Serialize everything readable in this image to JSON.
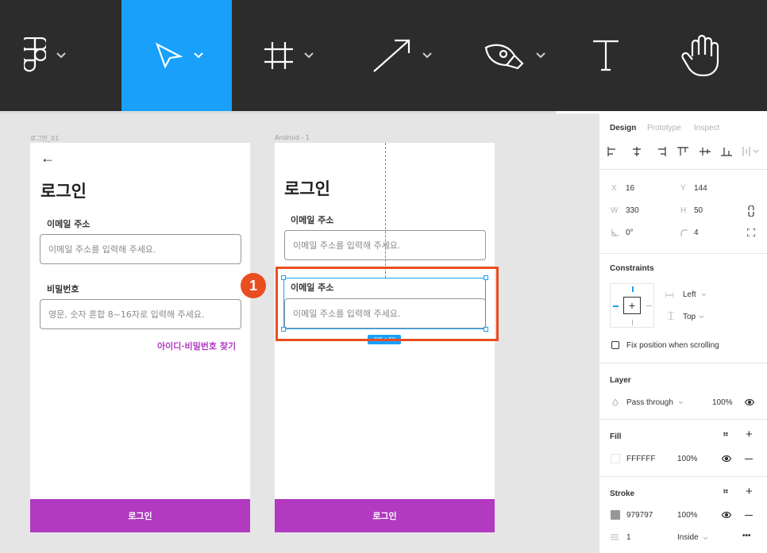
{
  "toolbar": {
    "tools": [
      "figma-menu",
      "move",
      "frame",
      "line",
      "pen",
      "text",
      "hand"
    ],
    "active_tool": "move"
  },
  "canvas": {
    "frame1": {
      "label": "로그인_01",
      "back": "←",
      "title": "로그인",
      "email_label": "이메일 주소",
      "email_placeholder": "이메일 주소를 입력해 주세요.",
      "password_label": "비밀번호",
      "password_placeholder": "영문, 숫자 혼합 8~16자로 입력해 주세요.",
      "find_link": "아이디·비밀번호 찾기",
      "login_button": "로그인"
    },
    "frame2": {
      "label": "Android - 1",
      "title": "로그인",
      "email_label": "이메일 주소",
      "email_placeholder": "이메일 주소를 입력해 주세요.",
      "dup_email_label": "이메일 주소",
      "dup_email_placeholder": "이메일 주소를 입력해 주세요.",
      "login_button": "로그인"
    },
    "step_badge": "1",
    "size_badge": "330 × 50"
  },
  "panel": {
    "tabs": [
      "Design",
      "Prototype",
      "Inspect"
    ],
    "active_tab": "Design",
    "x_label": "X",
    "x": "16",
    "y_label": "Y",
    "y": "144",
    "w_label": "W",
    "w": "330",
    "h_label": "H",
    "h": "50",
    "rotation": "0°",
    "radius": "4",
    "constraints_title": "Constraints",
    "constraint_h": "Left",
    "constraint_v": "Top",
    "fix_position": "Fix position when scrolling",
    "layer_title": "Layer",
    "blend": "Pass through",
    "layer_opacity": "100%",
    "fill_title": "Fill",
    "fill_hex": "FFFFFF",
    "fill_opacity": "100%",
    "stroke_title": "Stroke",
    "stroke_hex": "979797",
    "stroke_opacity": "100%",
    "stroke_width": "1",
    "stroke_align": "Inside",
    "more": "•••"
  },
  "colors": {
    "toolbar_bg": "#2c2c2c",
    "accent": "#18a0fb",
    "primary_button": "#b13ac0",
    "highlight": "#ea4d1f",
    "stroke": "#979797"
  }
}
